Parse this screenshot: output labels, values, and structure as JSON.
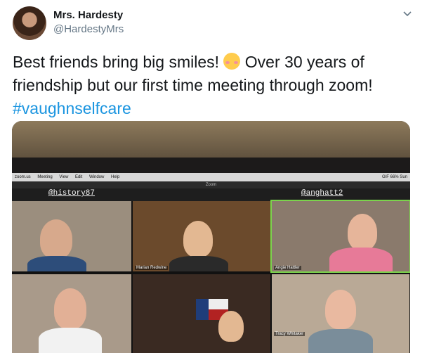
{
  "tweet": {
    "display_name": "Mrs. Hardesty",
    "handle": "@HardestyMrs",
    "text_part1": "Best friends bring big smiles! ",
    "text_part2": " Over 30 years of friendship but our first time meeting through zoom! ",
    "hashtag": "#vaughnselfcare",
    "emoji": "smiling-face-with-smiling-eyes"
  },
  "media": {
    "menubar_items": [
      "zoom.us",
      "Meeting",
      "View",
      "Edit",
      "Window",
      "Help"
    ],
    "menubar_right": "GIF  66%  Sun",
    "window_title": "Zoom",
    "handle_left": "@history87",
    "handle_right": "@anghatt2",
    "participants": [
      "Marian Redwine",
      "Angie Hattler",
      "Tracy Whitaker"
    ]
  },
  "colors": {
    "hashtag": "#1b95e0",
    "text": "#14171a",
    "muted": "#657786"
  }
}
